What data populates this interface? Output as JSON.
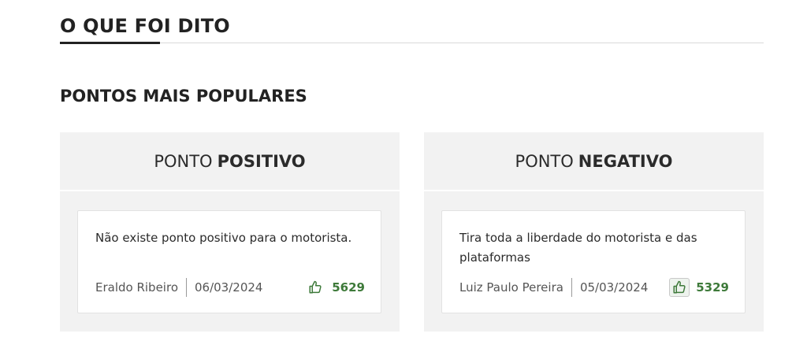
{
  "section": {
    "title": "O QUE FOI DITO"
  },
  "popular": {
    "title": "PONTOS MAIS POPULARES"
  },
  "columns": [
    {
      "label_light": "PONTO",
      "label_bold": "POSITIVO",
      "comment": {
        "text": "Não existe ponto positivo para o motorista.",
        "author": "Eraldo Ribeiro",
        "date": "06/03/2024",
        "likes": "5629"
      }
    },
    {
      "label_light": "PONTO",
      "label_bold": "NEGATIVO",
      "comment": {
        "text": "Tira toda a liberdade do motorista e das plataformas",
        "author": "Luiz Paulo Pereira",
        "date": "05/03/2024",
        "likes": "5329"
      }
    }
  ],
  "colors": {
    "accent_green": "#3e7a3a",
    "panel_bg": "#f2f2f2"
  },
  "icons": {
    "like": "thumbs-up-icon"
  }
}
